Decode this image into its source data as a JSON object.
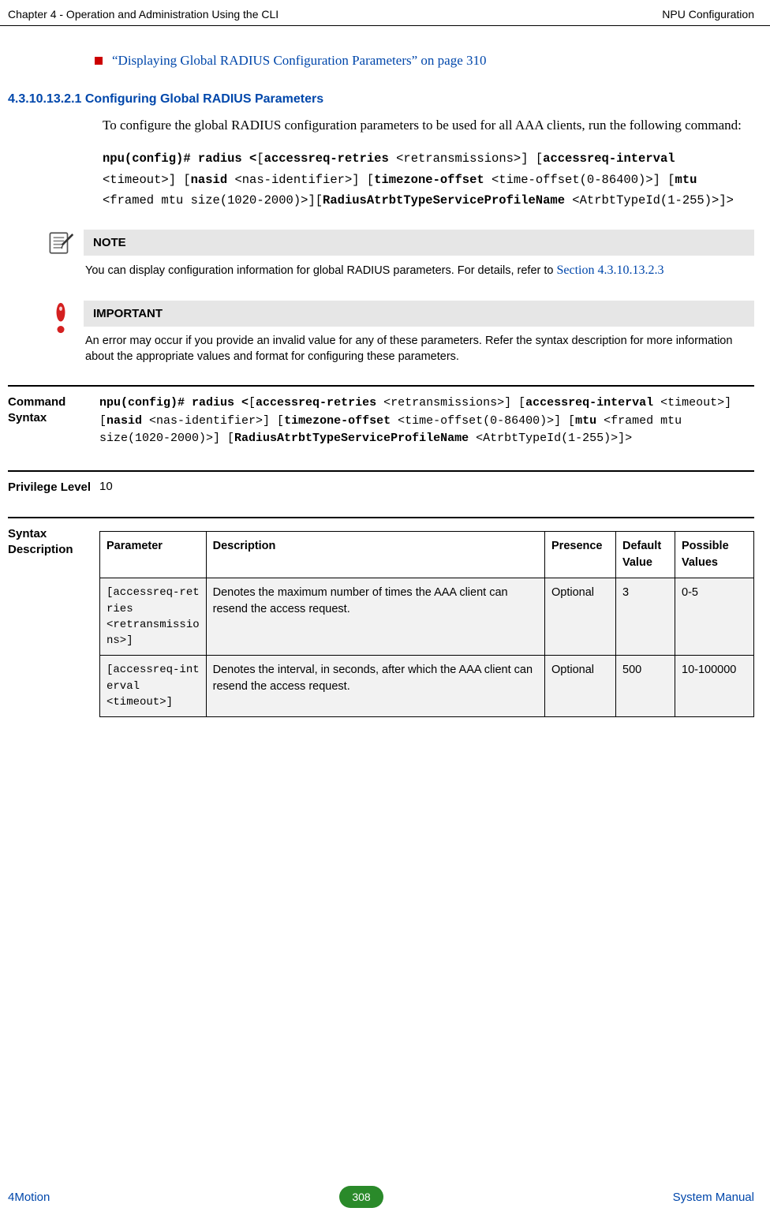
{
  "header": {
    "left": "Chapter 4 - Operation and Administration Using the CLI",
    "right": "NPU Configuration"
  },
  "bullet_link": "“Displaying Global RADIUS Configuration Parameters” on page 310",
  "heading": "4.3.10.13.2.1 Configuring Global RADIUS Parameters",
  "para1": "To configure the global RADIUS configuration parameters to be used for all AAA clients, run the following command:",
  "cmd1": "npu(config)# radius <[accessreq-retries <retransmissions>] [accessreq-interval <timeout>] [nasid <nas-identifier>] [timezone-offset <time-offset(0-86400)>] [mtu <framed mtu size(1020-2000)>][RadiusAtrbtTypeServiceProfileName <AtrbtTypeId(1-255)>]>",
  "note": {
    "title": "NOTE",
    "text_prefix": "You can display configuration information for global RADIUS parameters. For details, refer to ",
    "section_ref": "Section 4.3.10.13.2.3"
  },
  "important": {
    "title": "IMPORTANT",
    "text": "An error may occur if you provide an invalid  value for any of these parameters. Refer the syntax description for more information about the appropriate values and format for configuring these parameters."
  },
  "rows": {
    "command_label": "Command Syntax",
    "command_text": "npu(config)# radius <[accessreq-retries <retransmissions>] [accessreq-interval <timeout>] [nasid <nas-identifier>] [timezone-offset <time-offset(0-86400)>] [mtu <framed mtu size(1020-2000)>] [RadiusAtrbtTypeServiceProfileName <AtrbtTypeId(1-255)>]>",
    "privilege_label": "Privilege Level",
    "privilege_value": "10",
    "syntax_label": "Syntax Description"
  },
  "table": {
    "headers": {
      "param": "Parameter",
      "desc": "Description",
      "presence": "Presence",
      "default": "Default Value",
      "possible": "Possible Values"
    },
    "rows": [
      {
        "param": "[accessreq-retries <retransmissions>]",
        "desc": "Denotes the maximum number of times the AAA client can resend the access request.",
        "presence": "Optional",
        "default": "3",
        "possible": "0-5"
      },
      {
        "param": "[accessreq-interval <timeout>]",
        "desc": "Denotes the interval, in seconds, after which the AAA client can resend the access request.",
        "presence": "Optional",
        "default": "500",
        "possible": "10-100000"
      }
    ]
  },
  "footer": {
    "left": "4Motion",
    "page": "308",
    "right": "System Manual"
  }
}
